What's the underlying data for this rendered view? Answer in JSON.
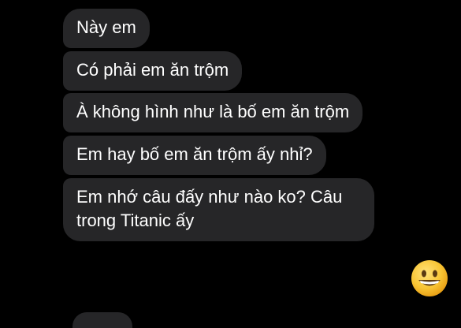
{
  "messages": [
    {
      "text": "Này em"
    },
    {
      "text": "Có phải em ăn trộm"
    },
    {
      "text": "À không hình như là bố em ăn trộm"
    },
    {
      "text": "Em hay bố em ăn trộm ấy nhỉ?"
    },
    {
      "text": "Em nhớ câu đấy như nào ko? Câu trong Titanic ấy"
    }
  ],
  "reply": {
    "icon": "grinning-face-emoji",
    "color": "#f5c531"
  },
  "colors": {
    "background": "#000000",
    "bubble": "#262628",
    "text": "#ffffff"
  }
}
